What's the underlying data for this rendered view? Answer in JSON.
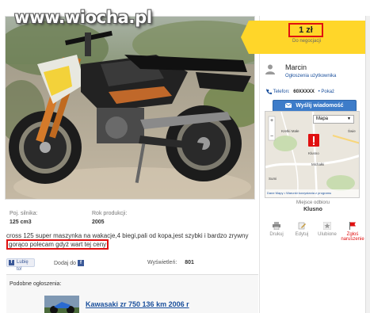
{
  "watermark": {
    "text": "www.wiocha.pl"
  },
  "listing": {
    "specs": [
      {
        "label": "Poj. silnika:",
        "value": "125 cm3"
      },
      {
        "label": "Rok produkcji:",
        "value": "2005"
      }
    ],
    "description_plain": "cross 125 super maszynka na wakacje,4 biegi,pali od kopa,jest szybki i bardzo zrywny",
    "description_highlight": "gorąco polecam gdyż wart tej ceny",
    "social": {
      "like_label": "Lubię to!",
      "add_label": "Dodaj do",
      "views_label": "Wyświetleń:",
      "views_value": "801"
    },
    "similar": {
      "title": "Podobne ogłoszenia:",
      "link": "Kawasaki zr 750 136 km 2006 r"
    }
  },
  "sidebar": {
    "price": "1 zł",
    "negotiable": "Do negocjacji",
    "seller": {
      "name": "Marcin",
      "type": "Ogłoszenia użytkownika"
    },
    "phone": {
      "label": "Telefon:",
      "value": "60XXXXX",
      "show": "• Pokaż"
    },
    "message_button": "Wyślij wiadomość",
    "map": {
      "type_select": "Mapa",
      "place_labels": [
        "Kretki Małe",
        "Świe",
        "Klusno",
        "Michałki",
        "Sumi"
      ],
      "footer": "Dane Mapy • Warunki korzystania z programu"
    },
    "location": {
      "label": "Miejsce odbioru",
      "value": "Klusno"
    },
    "actions": [
      {
        "label": "Drukuj",
        "icon": "printer-icon"
      },
      {
        "label": "Edytuj",
        "icon": "edit-icon"
      },
      {
        "label": "Ulubione",
        "icon": "star-icon"
      },
      {
        "label": "Zgłoś naruszenie",
        "icon": "flag-icon"
      }
    ]
  },
  "colors": {
    "price_bg": "#ffd629",
    "highlight_border": "#e01010",
    "button_blue": "#3d7cc9",
    "link_blue": "#1a4f9c"
  }
}
